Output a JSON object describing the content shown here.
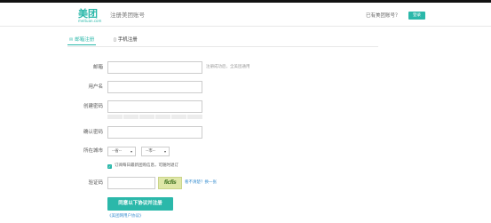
{
  "header": {
    "logo": "美团",
    "logo_sub": "meituan.com",
    "page_title": "注册美团账号",
    "has_account": "已有美团账号？",
    "login": "登录"
  },
  "tabs": {
    "email": "邮箱注册",
    "phone": "手机注册"
  },
  "form": {
    "email_label": "邮箱",
    "email_hint": "注册成功后，全美团通用",
    "username_label": "用户名",
    "password_label": "创建密码",
    "confirm_label": "确认密码",
    "city_label": "所在城市",
    "province_placeholder": "--省--",
    "city_placeholder": "--市--",
    "subscribe_text": "订阅每日最新团购信息，可随时退订",
    "captcha_label": "验证码",
    "captcha_image_text": "ficfis",
    "captcha_refresh": "看不清楚？换一张",
    "submit": "同意以下协议并注册",
    "agreement": "《美团网用户协议》"
  },
  "colors": {
    "accent": "#2bb8aa",
    "link": "#3a8fd0"
  }
}
